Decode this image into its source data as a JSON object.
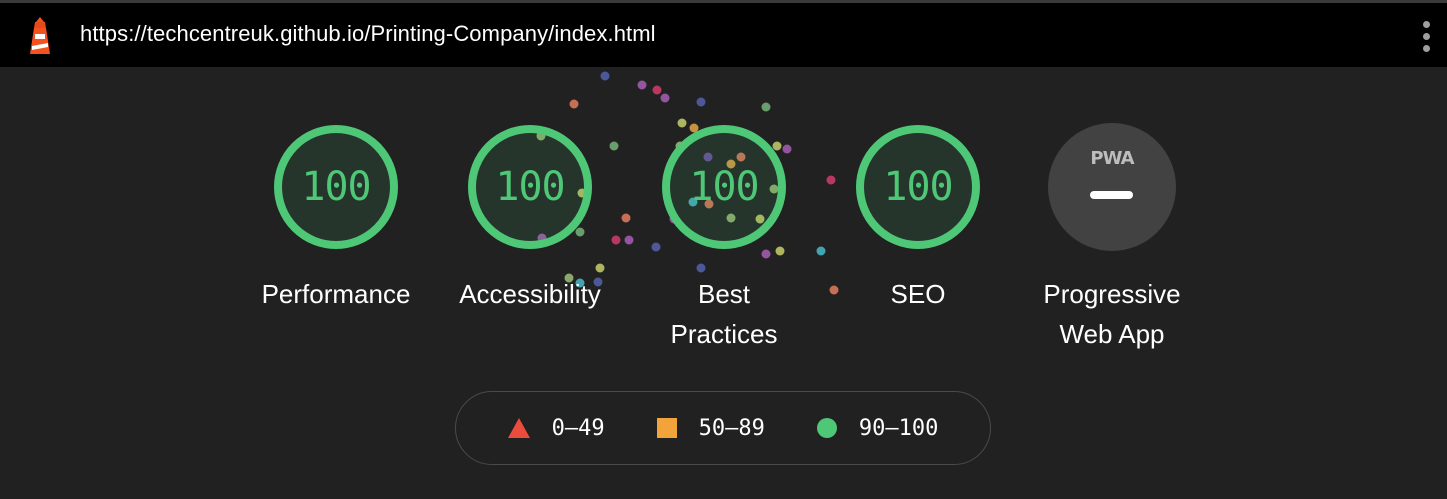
{
  "browser": {
    "url": "https://techcentreuk.github.io/Printing-Company/index.html",
    "logo_icon": "lighthouse-icon",
    "menu_icon": "more-vertical-icon"
  },
  "gauges": [
    {
      "label": "Performance",
      "score": "100"
    },
    {
      "label": "Accessibility",
      "score": "100"
    },
    {
      "label": "Best Practices",
      "score": "100"
    },
    {
      "label": "SEO",
      "score": "100"
    }
  ],
  "pwa": {
    "badge_text": "PWA",
    "label": "Progressive Web App",
    "status": "not-applicable"
  },
  "legend": [
    {
      "shape": "triangle",
      "range": "0–49",
      "color": "#eb4c3d"
    },
    {
      "shape": "square",
      "range": "50–89",
      "color": "#f2a43a"
    },
    {
      "shape": "circle",
      "range": "90–100",
      "color": "#4ec877"
    }
  ],
  "colors": {
    "pass": "#4ec877",
    "average": "#f2a43a",
    "fail": "#eb4c3d",
    "background": "#212121",
    "topbar": "#000000"
  }
}
